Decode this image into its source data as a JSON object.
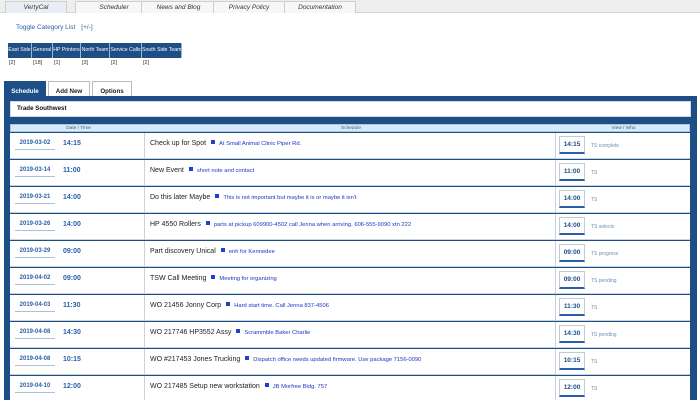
{
  "nav": {
    "tabs": [
      {
        "label": "VertyCal",
        "active": true
      },
      {
        "label": "Scheduler"
      },
      {
        "label": "News and Blog"
      },
      {
        "label": "Privacy Policy"
      },
      {
        "label": "Documentation"
      }
    ]
  },
  "categories": {
    "toggle_label": "Toggle Category List",
    "toggle_symbol": "[+/-]",
    "items": [
      {
        "name": "East Side",
        "count": "[2]"
      },
      {
        "name": "General",
        "count": "[18]"
      },
      {
        "name": "HP Printers",
        "count": "[1]"
      },
      {
        "name": "North Team",
        "count": "[3]"
      },
      {
        "name": "Service Calls",
        "count": "[2]"
      },
      {
        "name": "South Side Team",
        "count": "[2]"
      }
    ]
  },
  "panel_tabs": [
    {
      "label": "Schedule",
      "active": true
    },
    {
      "label": "Add New"
    },
    {
      "label": "Options"
    }
  ],
  "subheader": "Trade Southwest",
  "table": {
    "headers": [
      "Date / Time",
      "Schedule",
      "View / Who"
    ],
    "rows": [
      {
        "date": "2019-03-02",
        "time": "14:15",
        "title": "Check up for Spot",
        "note": "At Small Animal Clinic Piper Rd.",
        "vtime": "14:15",
        "who": "TS complete"
      },
      {
        "date": "2019-03-14",
        "time": "11:00",
        "title": "New Event",
        "note": "short note and contact",
        "vtime": "11:00",
        "who": "TS"
      },
      {
        "date": "2019-03-21",
        "time": "14:00",
        "title": "Do this later Maybe",
        "note": "This is not important but maybe it is or maybe it isn't",
        "vtime": "14:00",
        "who": "TS"
      },
      {
        "date": "2019-03-26",
        "time": "14:00",
        "title": "HP 4550 Rollers",
        "note": "parts at pickup 609900-4502 call Jenna when arriving. 606-555-9090 xtn 222",
        "vtime": "14:00",
        "who": "TS selects"
      },
      {
        "date": "2019-03-29",
        "time": "09:00",
        "title": "Part discovery Unical",
        "note": "enh for Kennedee",
        "vtime": "09:00",
        "who": "TS progress"
      },
      {
        "date": "2019-04-02",
        "time": "09:00",
        "title": "TSW Call Meeting",
        "note": "Meeting for organizing",
        "vtime": "09:00",
        "who": "TS pending"
      },
      {
        "date": "2019-04-03",
        "time": "11:30",
        "title": "WO 21456 Jonny Corp",
        "note": "Hard start time. Call Jenna 837-4506",
        "vtime": "11:30",
        "who": "TS"
      },
      {
        "date": "2019-04-08",
        "time": "14:30",
        "title": "WO 217746 HP3552 Assy",
        "note": "Scrammble Baker Charlie",
        "vtime": "14:30",
        "who": "TS pending"
      },
      {
        "date": "2019-04-08",
        "time": "10:15",
        "title": "WO #217453 Jones Trucking",
        "note": "Dispatch office needs updated firmware. Use package 7156-0090",
        "vtime": "10:15",
        "who": "TS"
      },
      {
        "date": "2019-04-10",
        "time": "12:00",
        "title": "WO 217485 Setup new workstation",
        "note": "JB Morfree Bldg. 757",
        "vtime": "12:00",
        "who": "TS"
      }
    ]
  }
}
